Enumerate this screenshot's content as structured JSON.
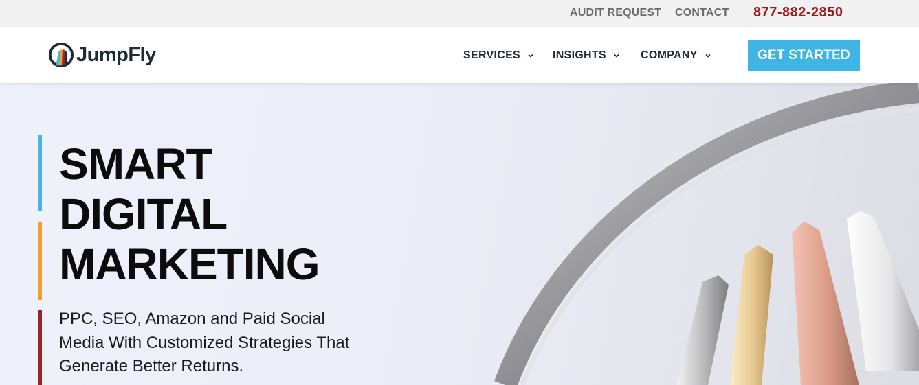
{
  "topbar": {
    "audit_request": "AUDIT REQUEST",
    "contact": "CONTACT",
    "phone": "877-882-2850"
  },
  "brand": {
    "name": "JumpFly",
    "logo_icon": "jumpfly-arc-logo-icon"
  },
  "nav": {
    "items": [
      {
        "label": "SERVICES",
        "icon": "chevron-down-icon"
      },
      {
        "label": "INSIGHTS",
        "icon": "chevron-down-icon"
      },
      {
        "label": "COMPANY",
        "icon": "chevron-down-icon"
      }
    ],
    "cta_label": "GET STARTED"
  },
  "hero": {
    "headline": [
      "SMART",
      "DIGITAL",
      "MARKETING"
    ],
    "subtext": "PPC, SEO, Amazon and Paid Social Media With Customized Strategies That Generate Better Returns."
  },
  "colors": {
    "accent_blue": "#3eb5e5",
    "accent_orange": "#f0a02a",
    "accent_red": "#9d2325",
    "phone_red": "#9b1c1c",
    "navy_text": "#1c2b3a"
  }
}
